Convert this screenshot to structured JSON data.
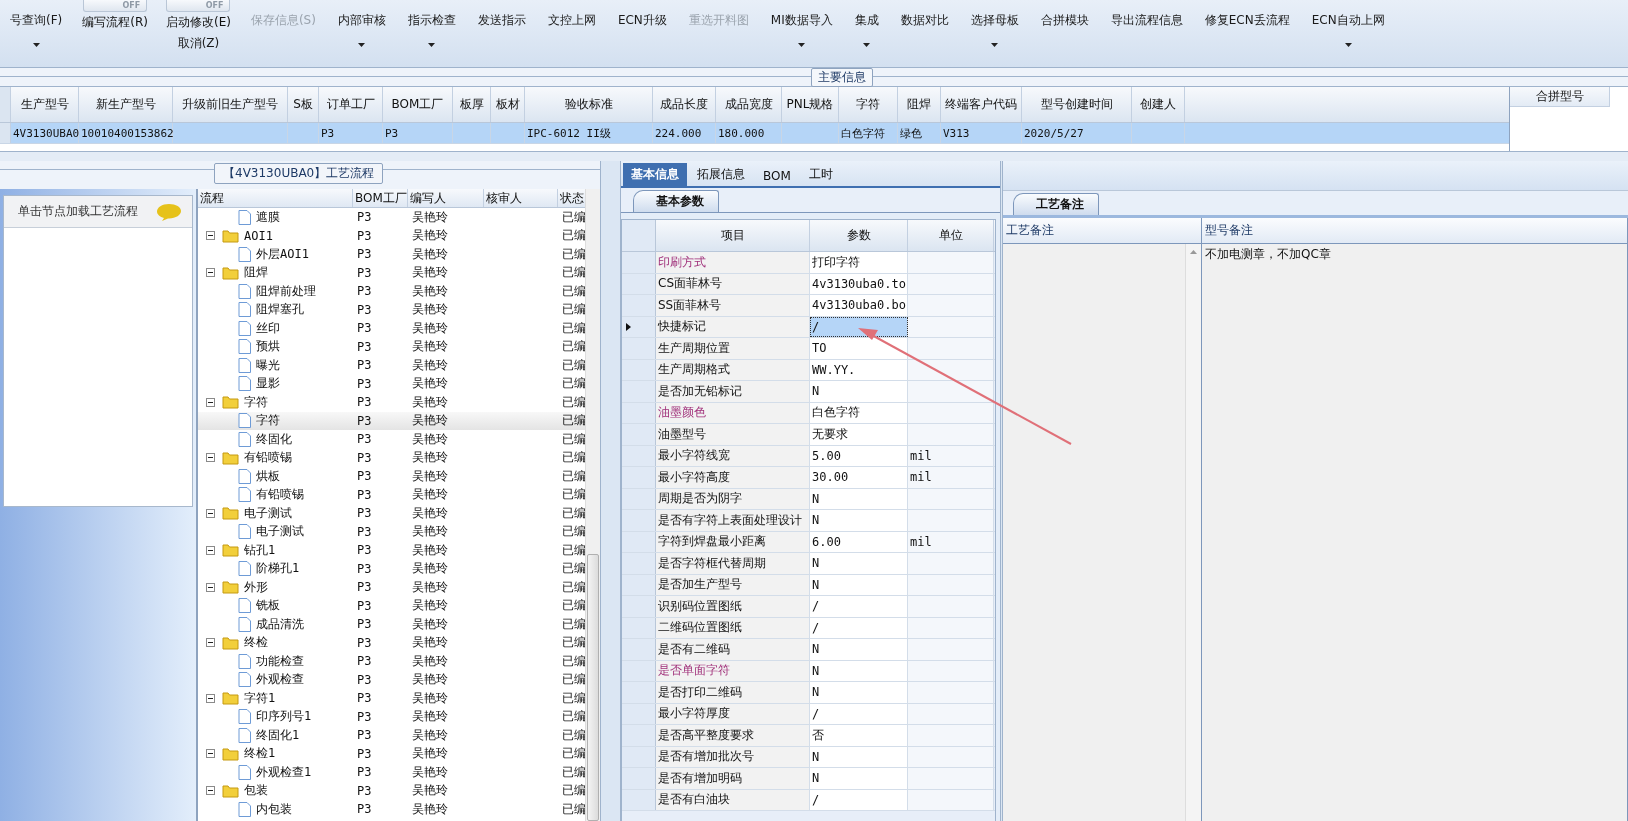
{
  "toolbar": {
    "items": [
      {
        "kind": "button",
        "label": "号查询(F)",
        "caret": true,
        "disabled": false
      },
      {
        "kind": "toggle",
        "switch": "OFF",
        "on": false,
        "label": "编写流程(R)"
      },
      {
        "kind": "toggle",
        "switch": "OFF",
        "on": false,
        "label": "启动修改(E)",
        "sub": "取消(Z)"
      },
      {
        "kind": "button",
        "label": "保存信息(S)",
        "caret": false,
        "disabled": true
      },
      {
        "kind": "button",
        "label": "内部审核",
        "caret": true,
        "disabled": false
      },
      {
        "kind": "button",
        "label": "指示检查",
        "caret": true,
        "disabled": false
      },
      {
        "kind": "button",
        "label": "发送指示",
        "caret": false,
        "disabled": false
      },
      {
        "kind": "button",
        "label": "文控上网",
        "caret": false,
        "disabled": false
      },
      {
        "kind": "button",
        "label": "ECN升级",
        "caret": false,
        "disabled": false
      },
      {
        "kind": "button",
        "label": "重选开料图",
        "caret": false,
        "disabled": true
      },
      {
        "kind": "button",
        "label": "MI数据导入",
        "caret": true,
        "disabled": false
      },
      {
        "kind": "button",
        "label": "集成",
        "caret": true,
        "disabled": false
      },
      {
        "kind": "button",
        "label": "数据对比",
        "caret": false,
        "disabled": false
      },
      {
        "kind": "button",
        "label": "选择母板",
        "caret": true,
        "disabled": false
      },
      {
        "kind": "button",
        "label": "合拼模块",
        "caret": false,
        "disabled": false
      },
      {
        "kind": "button",
        "label": "导出流程信息",
        "caret": false,
        "disabled": false
      },
      {
        "kind": "button",
        "label": "修复ECN丢流程",
        "caret": false,
        "disabled": false
      },
      {
        "kind": "button",
        "label": "ECN自动上网",
        "caret": true,
        "disabled": false
      }
    ]
  },
  "main_info": {
    "title": "主要信息",
    "columns": [
      "生产型号",
      "新生产型号",
      "升级前旧生产型号",
      "S板",
      "订单工厂",
      "BOM工厂",
      "板厚",
      "板材",
      "验收标准",
      "成品长度",
      "成品宽度",
      "PNL规格",
      "字符",
      "阻焊",
      "终端客户代码",
      "型号创建时间",
      "创建人"
    ],
    "rows": [
      {
        "selected": true,
        "cells": [
          "4V3130UBA0",
          "10010400153862",
          "",
          "",
          "P3",
          "P3",
          "",
          "",
          "IPC-6012 II级",
          "224.000",
          "180.000",
          "",
          "白色字符",
          "绿色",
          "V313",
          "2020/5/27",
          ""
        ]
      }
    ]
  },
  "merge_panel": {
    "title": "合拼型号"
  },
  "flow": {
    "title": "【4V3130UBA0】工艺流程",
    "hint": "单击节点加载工艺流程",
    "columns": [
      "流程",
      "BOM工厂",
      "编写人",
      "核审人",
      "状态"
    ],
    "tree": [
      {
        "kind": "file",
        "label": "遮膜",
        "bom": "P3",
        "writer": "吴艳玲",
        "status": "已编",
        "selected": false
      },
      {
        "kind": "folder",
        "label": "AOI1",
        "bom": "P3",
        "writer": "吴艳玲",
        "status": "已编",
        "selected": false,
        "expanded": true,
        "children": [
          {
            "kind": "file",
            "label": "外层AOI1",
            "bom": "P3",
            "writer": "吴艳玲",
            "status": "已编",
            "selected": false
          }
        ]
      },
      {
        "kind": "folder",
        "label": "阻焊",
        "bom": "P3",
        "writer": "吴艳玲",
        "status": "已编",
        "selected": false,
        "expanded": true,
        "children": [
          {
            "kind": "file",
            "label": "阻焊前处理",
            "bom": "P3",
            "writer": "吴艳玲",
            "status": "已编",
            "selected": false
          },
          {
            "kind": "file",
            "label": "阻焊塞孔",
            "bom": "P3",
            "writer": "吴艳玲",
            "status": "已编",
            "selected": false
          },
          {
            "kind": "file",
            "label": "丝印",
            "bom": "P3",
            "writer": "吴艳玲",
            "status": "已编",
            "selected": false
          },
          {
            "kind": "file",
            "label": "预烘",
            "bom": "P3",
            "writer": "吴艳玲",
            "status": "已编",
            "selected": false
          },
          {
            "kind": "file",
            "label": "曝光",
            "bom": "P3",
            "writer": "吴艳玲",
            "status": "已编",
            "selected": false
          },
          {
            "kind": "file",
            "label": "显影",
            "bom": "P3",
            "writer": "吴艳玲",
            "status": "已编",
            "selected": false
          }
        ]
      },
      {
        "kind": "folder",
        "label": "字符",
        "bom": "P3",
        "writer": "吴艳玲",
        "status": "已编",
        "selected": false,
        "expanded": true,
        "children": [
          {
            "kind": "file",
            "label": "字符",
            "bom": "P3",
            "writer": "吴艳玲",
            "status": "已编",
            "selected": true
          },
          {
            "kind": "file",
            "label": "终固化",
            "bom": "P3",
            "writer": "吴艳玲",
            "status": "已编",
            "selected": false
          }
        ]
      },
      {
        "kind": "folder",
        "label": "有铅喷锡",
        "bom": "P3",
        "writer": "吴艳玲",
        "status": "已编",
        "selected": false,
        "expanded": true,
        "children": [
          {
            "kind": "file",
            "label": "烘板",
            "bom": "P3",
            "writer": "吴艳玲",
            "status": "已编",
            "selected": false
          },
          {
            "kind": "file",
            "label": "有铅喷锡",
            "bom": "P3",
            "writer": "吴艳玲",
            "status": "已编",
            "selected": false
          }
        ]
      },
      {
        "kind": "folder",
        "label": "电子测试",
        "bom": "P3",
        "writer": "吴艳玲",
        "status": "已编",
        "selected": false,
        "expanded": true,
        "children": [
          {
            "kind": "file",
            "label": "电子测试",
            "bom": "P3",
            "writer": "吴艳玲",
            "status": "已编",
            "selected": false
          }
        ]
      },
      {
        "kind": "folder",
        "label": "钻孔1",
        "bom": "P3",
        "writer": "吴艳玲",
        "status": "已编",
        "selected": false,
        "expanded": true,
        "children": [
          {
            "kind": "file",
            "label": "阶梯孔1",
            "bom": "P3",
            "writer": "吴艳玲",
            "status": "已编",
            "selected": false
          }
        ]
      },
      {
        "kind": "folder",
        "label": "外形",
        "bom": "P3",
        "writer": "吴艳玲",
        "status": "已编",
        "selected": false,
        "expanded": true,
        "children": [
          {
            "kind": "file",
            "label": "铣板",
            "bom": "P3",
            "writer": "吴艳玲",
            "status": "已编",
            "selected": false
          },
          {
            "kind": "file",
            "label": "成品清洗",
            "bom": "P3",
            "writer": "吴艳玲",
            "status": "已编",
            "selected": false
          }
        ]
      },
      {
        "kind": "folder",
        "label": "终检",
        "bom": "P3",
        "writer": "吴艳玲",
        "status": "已编",
        "selected": false,
        "expanded": true,
        "children": [
          {
            "kind": "file",
            "label": "功能检查",
            "bom": "P3",
            "writer": "吴艳玲",
            "status": "已编",
            "selected": false
          },
          {
            "kind": "file",
            "label": "外观检查",
            "bom": "P3",
            "writer": "吴艳玲",
            "status": "已编",
            "selected": false
          }
        ]
      },
      {
        "kind": "folder",
        "label": "字符1",
        "bom": "P3",
        "writer": "吴艳玲",
        "status": "已编",
        "selected": false,
        "expanded": true,
        "children": [
          {
            "kind": "file",
            "label": "印序列号1",
            "bom": "P3",
            "writer": "吴艳玲",
            "status": "已编",
            "selected": false
          },
          {
            "kind": "file",
            "label": "终固化1",
            "bom": "P3",
            "writer": "吴艳玲",
            "status": "已编",
            "selected": false
          }
        ]
      },
      {
        "kind": "folder",
        "label": "终检1",
        "bom": "P3",
        "writer": "吴艳玲",
        "status": "已编",
        "selected": false,
        "expanded": true,
        "children": [
          {
            "kind": "file",
            "label": "外观检查1",
            "bom": "P3",
            "writer": "吴艳玲",
            "status": "已编",
            "selected": false
          }
        ]
      },
      {
        "kind": "folder",
        "label": "包装",
        "bom": "P3",
        "writer": "吴艳玲",
        "status": "已编",
        "selected": false,
        "expanded": true,
        "children": [
          {
            "kind": "file",
            "label": "内包装",
            "bom": "P3",
            "writer": "吴艳玲",
            "status": "已编",
            "selected": false
          }
        ]
      }
    ]
  },
  "detail": {
    "tabs": [
      {
        "label": "基本信息",
        "selected": true
      },
      {
        "label": "拓展信息",
        "selected": false
      },
      {
        "label": "BOM",
        "selected": false
      },
      {
        "label": "工时",
        "selected": false
      }
    ],
    "subtab": "基本参数",
    "columns": [
      "项目",
      "参数",
      "单位"
    ],
    "rows": [
      {
        "item": "印刷方式",
        "value": "打印字符",
        "emphasized": true,
        "selected": false
      },
      {
        "item": "CS面菲林号",
        "value": "4v3130uba0.to",
        "emphasized": false,
        "selected": false
      },
      {
        "item": "SS面菲林号",
        "value": "4v3130uba0.bo",
        "emphasized": false,
        "selected": false
      },
      {
        "item": "快捷标记",
        "value": "/",
        "emphasized": false,
        "selected": true
      },
      {
        "item": "生产周期位置",
        "value": "TO",
        "emphasized": false,
        "selected": false
      },
      {
        "item": "生产周期格式",
        "value": "WW.YY.",
        "emphasized": false,
        "selected": false
      },
      {
        "item": "是否加无铅标记",
        "value": "N",
        "emphasized": false,
        "selected": false
      },
      {
        "item": "油墨颜色",
        "value": "白色字符",
        "emphasized": true,
        "selected": false
      },
      {
        "item": "油墨型号",
        "value": "无要求",
        "emphasized": false,
        "selected": false
      },
      {
        "item": "最小字符线宽",
        "value": "5.00",
        "unit": "mil",
        "emphasized": false,
        "selected": false
      },
      {
        "item": "最小字符高度",
        "value": "30.00",
        "unit": "mil",
        "emphasized": false,
        "selected": false
      },
      {
        "item": "周期是否为阴字",
        "value": "N",
        "emphasized": false,
        "selected": false
      },
      {
        "item": "是否有字符上表面处理设计",
        "value": "N",
        "emphasized": false,
        "selected": false
      },
      {
        "item": "字符到焊盘最小距离",
        "value": "6.00",
        "unit": "mil",
        "emphasized": false,
        "selected": false
      },
      {
        "item": "是否字符框代替周期",
        "value": "N",
        "emphasized": false,
        "selected": false
      },
      {
        "item": "是否加生产型号",
        "value": "N",
        "emphasized": false,
        "selected": false
      },
      {
        "item": "识别码位置图纸",
        "value": "/",
        "emphasized": false,
        "selected": false
      },
      {
        "item": "二维码位置图纸",
        "value": "/",
        "emphasized": false,
        "selected": false
      },
      {
        "item": "是否有二维码",
        "value": "N",
        "emphasized": false,
        "selected": false
      },
      {
        "item": "是否单面字符",
        "value": "N",
        "emphasized": true,
        "selected": false
      },
      {
        "item": "是否打印二维码",
        "value": "N",
        "emphasized": false,
        "selected": false
      },
      {
        "item": "最小字符厚度",
        "value": "/",
        "emphasized": false,
        "selected": false
      },
      {
        "item": "是否高平整度要求",
        "value": "否",
        "emphasized": false,
        "selected": false
      },
      {
        "item": "是否有增加批次号",
        "value": "N",
        "emphasized": false,
        "selected": false
      },
      {
        "item": "是否有增加明码",
        "value": "N",
        "emphasized": false,
        "selected": false
      },
      {
        "item": "是否有白油块",
        "value": "/",
        "emphasized": false,
        "selected": false
      }
    ]
  },
  "notes": {
    "tab": "工艺备注",
    "columns": [
      "工艺备注",
      "型号备注"
    ],
    "model_note": "不加电测章，不加QC章"
  }
}
